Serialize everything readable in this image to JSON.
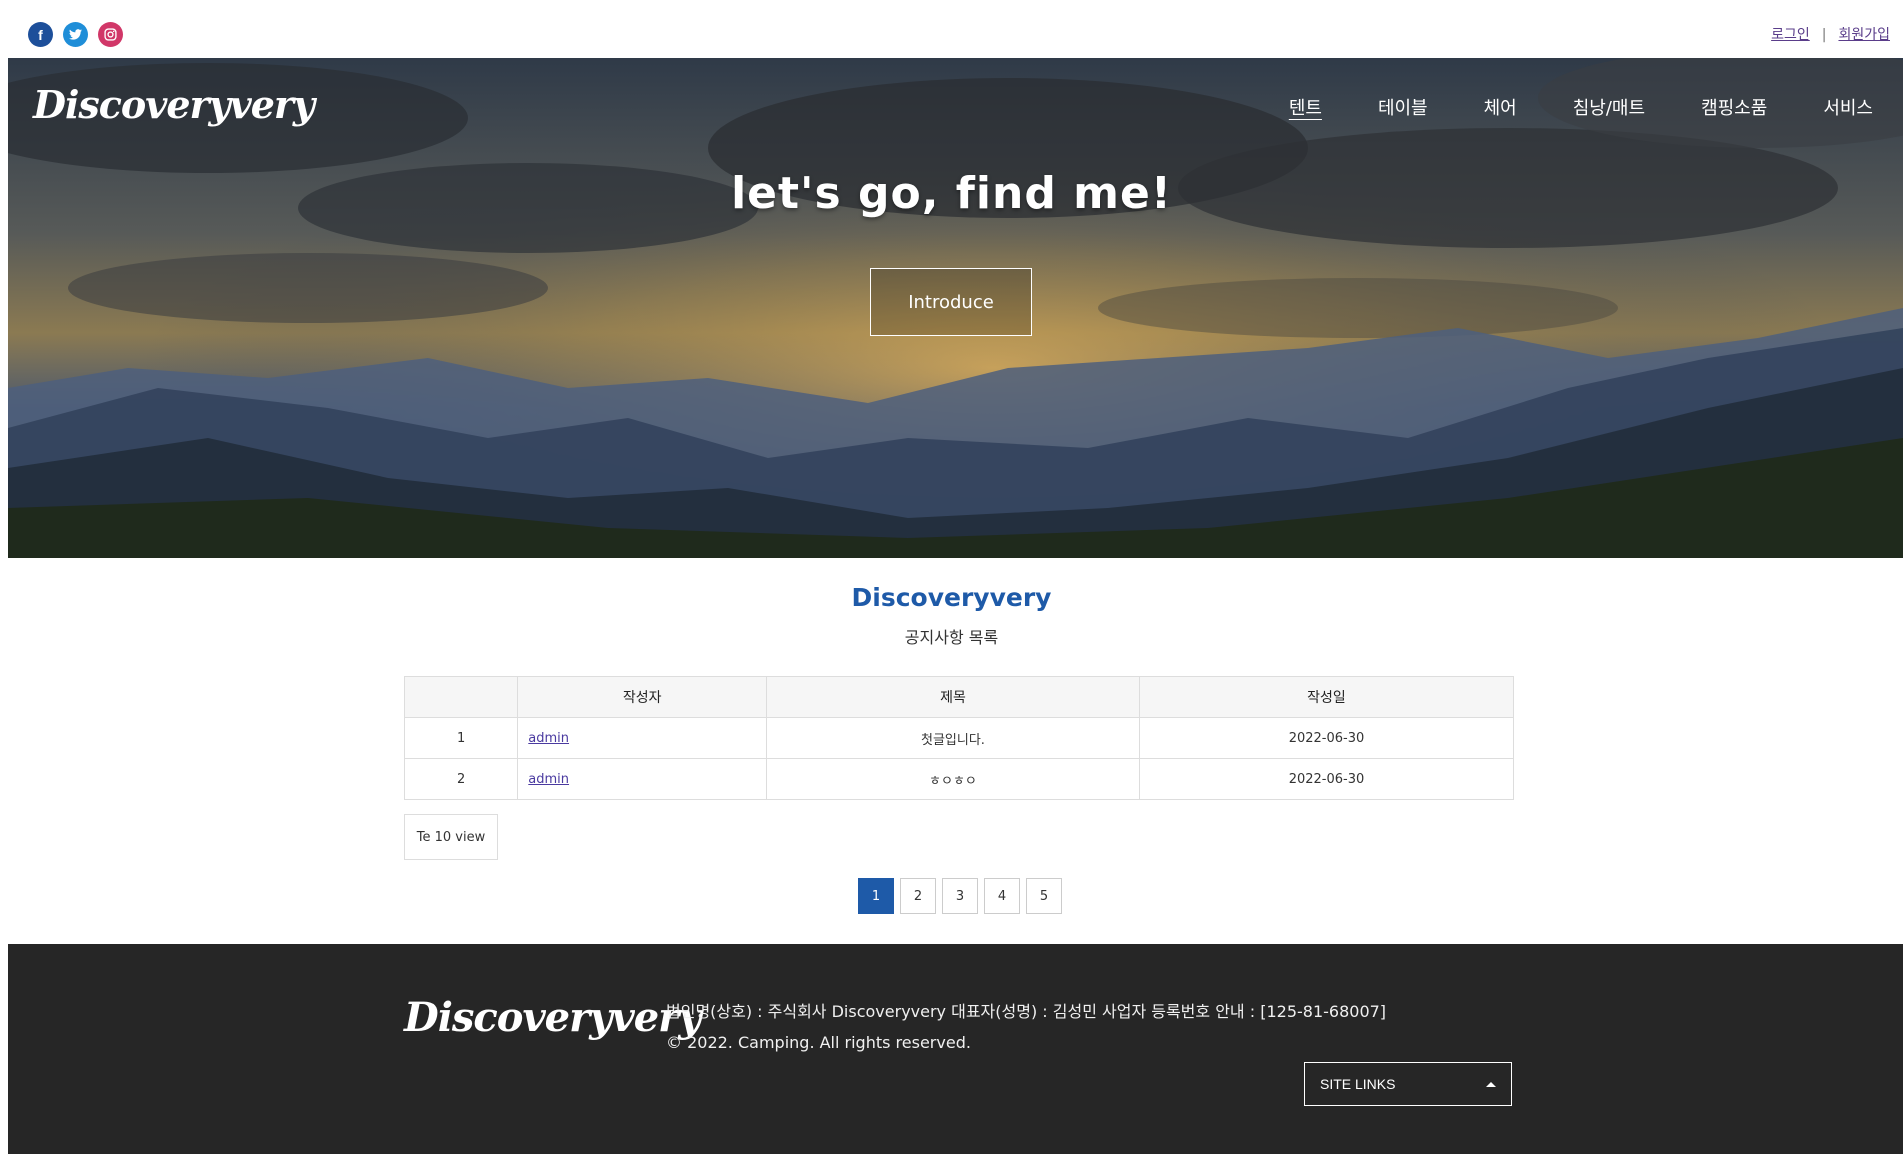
{
  "social": {
    "facebook": "f",
    "twitter": "t",
    "instagram": "◎"
  },
  "auth": {
    "login": "로그인",
    "separator": "|",
    "signup": "회원가입"
  },
  "brand": {
    "logo": "Discoveryvery",
    "name": "Discoveryvery"
  },
  "nav": {
    "items": [
      "텐트",
      "테이블",
      "체어",
      "침낭/매트",
      "캠핑소품",
      "서비스"
    ]
  },
  "hero": {
    "title": "let's go, find me!",
    "button": "Introduce"
  },
  "board": {
    "subtitle": "공지사항 목록",
    "columns": [
      "",
      "작성자",
      "제목",
      "작성일"
    ],
    "rows": [
      {
        "no": "1",
        "writer": "admin",
        "title": "첫글입니다.",
        "date": "2022-06-30"
      },
      {
        "no": "2",
        "writer": "admin",
        "title": "ㅎㅇㅎㅇ",
        "date": "2022-06-30"
      }
    ],
    "view_select": "Te 10 view"
  },
  "pagination": {
    "pages": [
      "1",
      "2",
      "3",
      "4",
      "5"
    ],
    "current": "1"
  },
  "footer": {
    "logo": "Discoveryvery",
    "company": "법인명(상호) : 주식회사 Discoveryvery 대표자(성명) : 김성민 사업자 등록번호 안내 : [125-81-68007]",
    "copyright": "© 2022. Camping. All rights reserved.",
    "site_links": "SITE LINKS"
  },
  "colors": {
    "accent": "#1e5aa8",
    "footer_bg": "#262626"
  }
}
